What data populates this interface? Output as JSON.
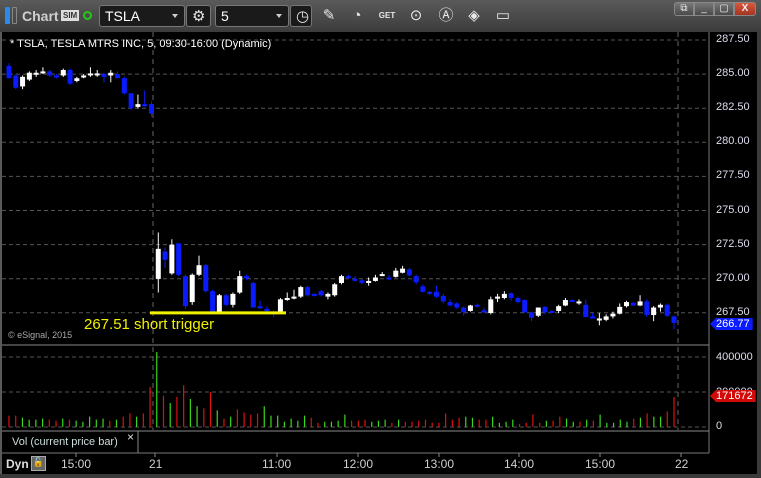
{
  "toolbar": {
    "title": "Chart",
    "sim_badge": "SIM",
    "symbol": "TSLA",
    "interval": "5",
    "icons": [
      "link-icon",
      "connection-status-icon",
      "settings-icon",
      "clock-icon",
      "pencil-icon",
      "studies-icon",
      "get-icon",
      "play-icon",
      "alert-icon",
      "tag-icon",
      "comment-icon"
    ]
  },
  "window": {
    "buttons": [
      "link-window",
      "minimize",
      "maximize",
      "close"
    ],
    "close_label": "X"
  },
  "chart": {
    "header": "* TSLA, TESLA MTRS INC, 5, 09:30-16:00 (Dynamic)",
    "copyright": "© eSignal, 2015",
    "annotation": "267.51 short trigger",
    "trigger_price": 267.51,
    "last_price": "266.77",
    "price_labels": [
      "287.50",
      "285.00",
      "282.50",
      "280.00",
      "277.50",
      "275.00",
      "272.50",
      "270.00",
      "267.50"
    ],
    "volume_labels": [
      "400000",
      "200000",
      "0"
    ],
    "last_volume": "171672",
    "volume_study_label": "Vol (current price bar)",
    "close_study": "×",
    "dyn_label": "Dyn",
    "time_labels": [
      "15:00",
      "21",
      "11:00",
      "12:00",
      "13:00",
      "14:00",
      "15:00",
      "22"
    ],
    "colors": {
      "down": "#0a1cff",
      "up": "#ffffff",
      "vol_up": "#3ad81c",
      "vol_down": "#e01010",
      "trigger": "#f2f200",
      "last_price_bg": "#0a1cff",
      "last_vol_bg": "#d10a0a"
    }
  },
  "chart_data": {
    "type": "candlestick",
    "title": "TSLA, TESLA MTRS INC, 5-min",
    "ylim": [
      265.8,
      288.5
    ],
    "ohlc": [
      [
        285.6,
        285.8,
        284.7,
        284.7
      ],
      [
        284.9,
        285.0,
        283.9,
        284.0
      ],
      [
        284.1,
        284.9,
        283.9,
        284.8
      ],
      [
        284.6,
        285.2,
        284.5,
        285.1
      ],
      [
        285.0,
        285.3,
        284.8,
        285.1
      ],
      [
        285.1,
        285.5,
        285.0,
        285.2
      ],
      [
        285.2,
        285.3,
        284.8,
        284.9
      ],
      [
        284.9,
        285.0,
        284.7,
        284.8
      ],
      [
        284.9,
        285.4,
        284.8,
        285.3
      ],
      [
        285.3,
        285.4,
        284.2,
        284.3
      ],
      [
        284.5,
        284.8,
        284.4,
        284.7
      ],
      [
        284.8,
        285.0,
        284.7,
        284.9
      ],
      [
        285.0,
        285.5,
        284.8,
        285.05
      ],
      [
        285.0,
        285.3,
        284.8,
        285.05
      ],
      [
        285.0,
        285.1,
        284.4,
        284.8
      ],
      [
        284.9,
        285.3,
        284.4,
        285.1
      ],
      [
        285.0,
        285.2,
        284.7,
        284.7
      ],
      [
        284.7,
        284.8,
        283.5,
        283.6
      ],
      [
        283.6,
        283.6,
        282.4,
        282.5
      ],
      [
        282.6,
        283.5,
        282.5,
        282.8
      ],
      [
        282.8,
        283.8,
        282.6,
        282.7
      ],
      [
        282.8,
        283.0,
        281.9,
        282.1
      ],
      [
        270.0,
        273.4,
        269.0,
        272.2
      ],
      [
        272.0,
        272.3,
        270.8,
        271.4
      ],
      [
        270.4,
        272.9,
        270.3,
        272.5
      ],
      [
        272.6,
        272.6,
        270.2,
        270.3
      ],
      [
        270.2,
        270.3,
        267.8,
        268.0
      ],
      [
        268.3,
        270.4,
        268.1,
        270.3
      ],
      [
        270.3,
        271.7,
        270.2,
        271.0
      ],
      [
        271.0,
        271.1,
        269.0,
        269.1
      ],
      [
        269.1,
        269.2,
        267.4,
        267.5
      ],
      [
        267.6,
        268.9,
        267.5,
        268.8
      ],
      [
        268.8,
        268.9,
        268.0,
        268.1
      ],
      [
        268.1,
        269.0,
        267.9,
        268.9
      ],
      [
        269.0,
        270.6,
        268.9,
        270.2
      ],
      [
        270.2,
        270.3,
        269.9,
        270.1
      ],
      [
        269.7,
        269.8,
        267.9,
        267.9
      ],
      [
        268.0,
        268.4,
        267.8,
        267.9
      ],
      [
        267.8,
        268.0,
        267.6,
        267.7
      ],
      [
        267.6,
        267.7,
        267.2,
        267.4
      ],
      [
        267.6,
        268.6,
        267.5,
        268.5
      ],
      [
        268.5,
        269.0,
        268.4,
        268.6
      ],
      [
        268.6,
        269.2,
        268.5,
        268.7
      ],
      [
        268.7,
        269.5,
        268.6,
        269.4
      ],
      [
        269.4,
        269.5,
        268.7,
        268.8
      ],
      [
        268.9,
        268.9,
        268.7,
        268.8
      ],
      [
        269.1,
        269.2,
        268.7,
        268.8
      ],
      [
        268.7,
        269.0,
        268.5,
        268.9
      ],
      [
        268.8,
        269.7,
        268.7,
        269.6
      ],
      [
        269.7,
        270.3,
        269.6,
        270.2
      ],
      [
        270.2,
        270.3,
        270.0,
        270.1
      ],
      [
        270.0,
        270.2,
        269.8,
        269.9
      ],
      [
        269.9,
        270.0,
        269.6,
        269.7
      ],
      [
        269.7,
        270.1,
        269.5,
        269.85
      ],
      [
        269.85,
        270.3,
        269.8,
        270.1
      ],
      [
        270.25,
        270.5,
        270.2,
        270.35
      ],
      [
        270.1,
        270.3,
        269.9,
        270.0
      ],
      [
        270.15,
        270.8,
        270.1,
        270.6
      ],
      [
        270.45,
        270.95,
        270.4,
        270.75
      ],
      [
        270.7,
        270.8,
        270.2,
        270.25
      ],
      [
        270.2,
        270.3,
        269.6,
        269.75
      ],
      [
        269.45,
        269.6,
        269.0,
        269.05
      ],
      [
        269.05,
        269.1,
        268.8,
        268.9
      ],
      [
        269.05,
        269.5,
        268.6,
        268.7
      ],
      [
        268.75,
        268.9,
        268.2,
        268.35
      ],
      [
        268.3,
        268.5,
        268.0,
        268.05
      ],
      [
        268.2,
        268.3,
        267.8,
        267.9
      ],
      [
        267.9,
        268.0,
        267.3,
        267.55
      ],
      [
        267.65,
        268.1,
        267.6,
        268.05
      ],
      [
        268.1,
        268.2,
        267.9,
        268.0
      ],
      [
        267.7,
        267.9,
        267.5,
        267.55
      ],
      [
        267.5,
        268.7,
        267.4,
        268.5
      ],
      [
        268.55,
        268.9,
        268.3,
        268.7
      ],
      [
        268.6,
        269.1,
        268.5,
        268.9
      ],
      [
        268.95,
        269.0,
        268.4,
        268.6
      ],
      [
        268.6,
        268.7,
        268.2,
        268.3
      ],
      [
        268.45,
        268.5,
        267.5,
        267.55
      ],
      [
        267.55,
        267.6,
        266.9,
        267.15
      ],
      [
        267.3,
        267.9,
        267.2,
        267.9
      ],
      [
        267.95,
        268.0,
        267.4,
        267.55
      ],
      [
        267.65,
        267.7,
        267.5,
        267.55
      ],
      [
        267.65,
        268.1,
        267.5,
        268.0
      ],
      [
        268.05,
        268.6,
        268.0,
        268.45
      ],
      [
        268.45,
        268.5,
        268.3,
        268.35
      ],
      [
        268.2,
        268.5,
        268.1,
        268.35
      ],
      [
        268.1,
        268.5,
        267.2,
        267.2
      ],
      [
        267.25,
        267.5,
        267.1,
        267.15
      ],
      [
        266.95,
        267.5,
        266.6,
        267.1
      ],
      [
        267.0,
        267.4,
        266.9,
        267.25
      ],
      [
        267.25,
        267.6,
        267.1,
        267.45
      ],
      [
        267.45,
        268.2,
        267.4,
        267.95
      ],
      [
        268.0,
        268.4,
        267.9,
        268.3
      ],
      [
        268.25,
        268.3,
        268.0,
        268.05
      ],
      [
        268.05,
        268.8,
        268.0,
        268.35
      ],
      [
        268.35,
        268.5,
        267.2,
        267.35
      ],
      [
        267.35,
        268.0,
        266.9,
        267.9
      ],
      [
        267.9,
        268.2,
        267.6,
        268.1
      ],
      [
        268.1,
        268.2,
        267.2,
        267.3
      ],
      [
        267.25,
        267.3,
        266.3,
        266.77
      ]
    ],
    "volume": [
      65000,
      65000,
      53000,
      42000,
      42000,
      48000,
      42000,
      36000,
      48000,
      42000,
      36000,
      30000,
      59000,
      42000,
      48000,
      36000,
      42000,
      59000,
      77000,
      59000,
      77000,
      228000,
      428000,
      178000,
      137000,
      172000,
      238000,
      160000,
      119000,
      107000,
      200000,
      95000,
      48000,
      59000,
      101000,
      83000,
      71000,
      77000,
      119000,
      65000,
      65000,
      30000,
      48000,
      36000,
      65000,
      53000,
      24000,
      30000,
      30000,
      36000,
      71000,
      36000,
      36000,
      42000,
      30000,
      36000,
      42000,
      24000,
      42000,
      30000,
      30000,
      36000,
      42000,
      24000,
      24000,
      77000,
      42000,
      53000,
      59000,
      53000,
      42000,
      42000,
      59000,
      24000,
      30000,
      42000,
      18000,
      24000,
      71000,
      24000,
      36000,
      36000,
      59000,
      48000,
      30000,
      30000,
      42000,
      36000,
      71000,
      24000,
      24000,
      42000,
      30000,
      48000,
      53000,
      77000,
      59000,
      59000,
      89000,
      171672
    ],
    "volume_up": "rrgggrrrgrgggggrgrrrgrr",
    "volume_colors": "rrggggrrgrgggggrgrrgrrgrgrrggrrgrgrrrrgggggggrrggggrrrgggrgrrrrrrrrrggrrggggrrrrgrrggrgrgggggrgrggrr"
  }
}
